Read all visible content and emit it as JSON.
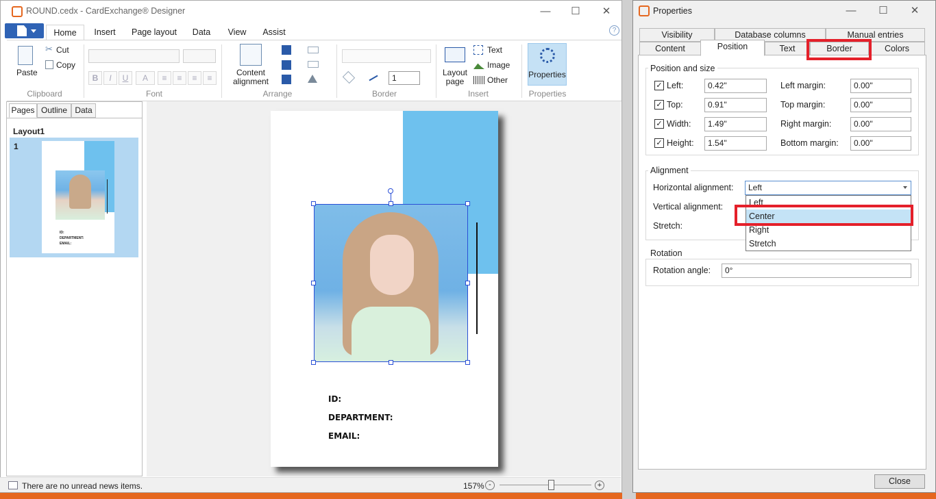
{
  "main_window": {
    "title": "ROUND.cedx - CardExchange® Designer",
    "minimize": "—",
    "maximize": "☐",
    "close": "✕",
    "help": "?"
  },
  "ribbon": {
    "tabs": [
      "Home",
      "Insert",
      "Page layout",
      "Data",
      "View",
      "Assist"
    ],
    "active_tab": "Home",
    "clipboard": {
      "paste": "Paste",
      "cut": "Cut",
      "copy": "Copy",
      "label": "Clipboard"
    },
    "font": {
      "label": "Font",
      "bold": "B",
      "italic": "I",
      "underline": "U",
      "color": "A"
    },
    "arrange": {
      "content_alignment": "Content alignment",
      "label": "Arrange"
    },
    "border": {
      "label": "Border",
      "width_value": "1"
    },
    "insert": {
      "layout_page": "Layout page",
      "text": "Text",
      "image": "Image",
      "other": "Other",
      "label": "Insert"
    },
    "properties": {
      "button": "Properties",
      "label": "Properties"
    }
  },
  "left_pane": {
    "tabs": [
      "Pages",
      "Outline",
      "Data"
    ],
    "active_tab": "Pages",
    "layout_name": "Layout1",
    "page_number": "1",
    "thumb_labels": [
      "ID:",
      "DEPARTMENT:",
      "EMAIL:"
    ]
  },
  "card": {
    "labels": [
      "ID:",
      "DEPARTMENT:",
      "EMAIL:"
    ],
    "accent_color": "#6ec1ee"
  },
  "status_bar": {
    "news": "There are no unread news items.",
    "zoom": "157%",
    "zoom_out": "-",
    "zoom_in": "+"
  },
  "properties": {
    "title": "Properties",
    "tabs_row1": [
      "Visibility",
      "Database columns",
      "Manual entries"
    ],
    "tabs_row2": [
      "Content",
      "Position",
      "Text",
      "Border",
      "Colors"
    ],
    "active_tab": "Position",
    "position_and_size": {
      "legend": "Position and size",
      "fields": [
        {
          "label": "Left:",
          "value": "0.42\"",
          "margin_label": "Left margin:",
          "margin_value": "0.00\""
        },
        {
          "label": "Top:",
          "value": "0.91\"",
          "margin_label": "Top margin:",
          "margin_value": "0.00\""
        },
        {
          "label": "Width:",
          "value": "1.49\"",
          "margin_label": "Right margin:",
          "margin_value": "0.00\""
        },
        {
          "label": "Height:",
          "value": "1.54\"",
          "margin_label": "Bottom margin:",
          "margin_value": "0.00\""
        }
      ],
      "check": "✓"
    },
    "alignment": {
      "legend": "Alignment",
      "horizontal_label": "Horizontal alignment:",
      "horizontal_value": "Left",
      "vertical_label": "Vertical alignment:",
      "stretch_label": "Stretch:",
      "options": [
        "Left",
        "Center",
        "Right",
        "Stretch"
      ],
      "highlighted": "Center"
    },
    "rotation": {
      "legend": "Rotation",
      "label": "Rotation angle:",
      "value": "0°"
    },
    "close_button": "Close",
    "highlight_color": "#e4202a"
  }
}
